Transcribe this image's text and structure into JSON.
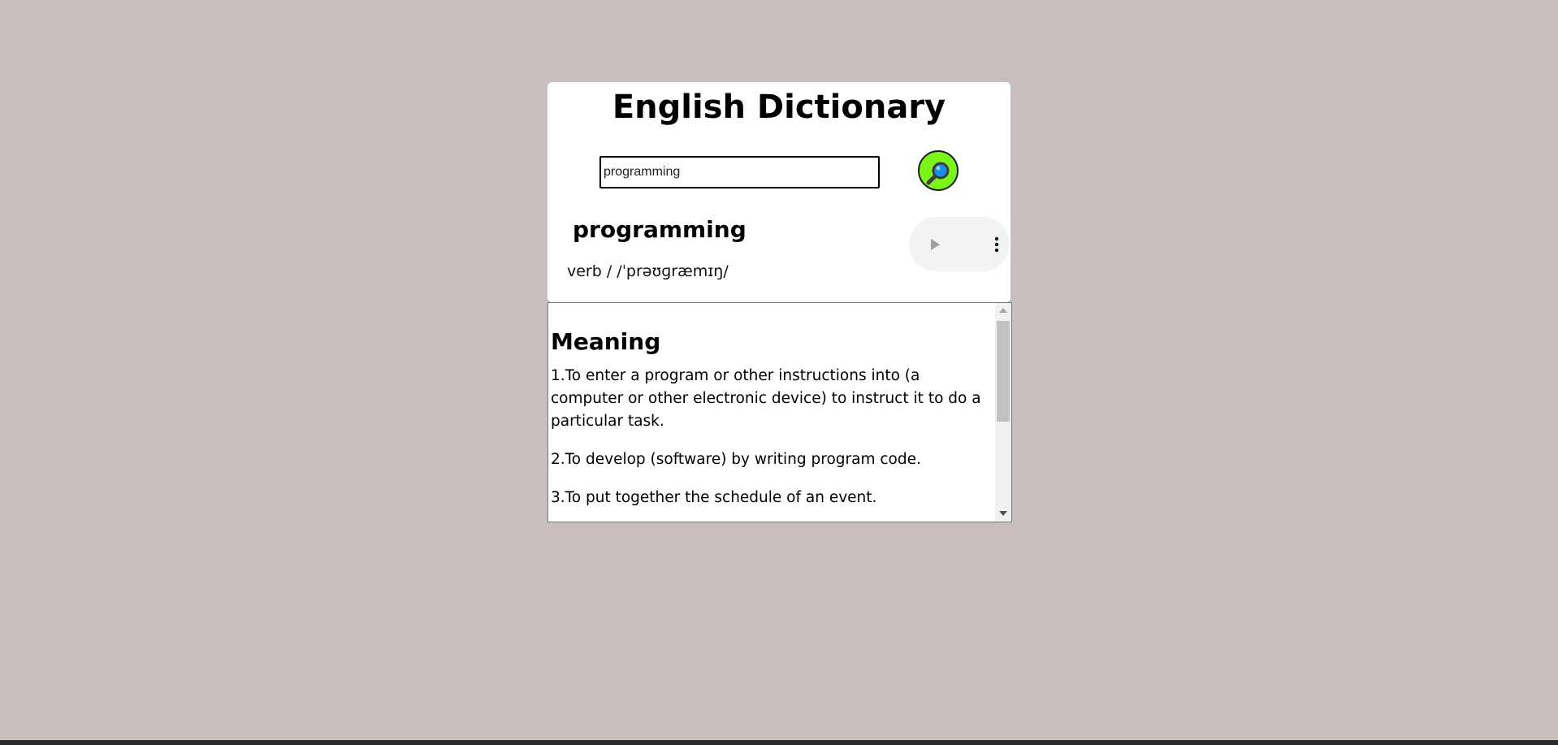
{
  "app": {
    "title": "English Dictionary"
  },
  "search": {
    "value": "programming",
    "button_icon": "magnifier-icon"
  },
  "result": {
    "word": "programming",
    "phonetic": "verb / /ˈprəʊɡræmɪŋ/"
  },
  "audio": {
    "play_icon": "play-icon",
    "menu_icon": "more-vertical-icon"
  },
  "meaning": {
    "heading": "Meaning",
    "definitions": [
      "1.To enter a program or other instructions into (a computer or other electronic device) to instruct it to do a particular task.",
      "2.To develop (software) by writing program code.",
      "3.To put together the schedule of an event."
    ]
  },
  "colors": {
    "background": "#c9bebe",
    "search_button": "#7cf51a",
    "card": "#ffffff"
  }
}
